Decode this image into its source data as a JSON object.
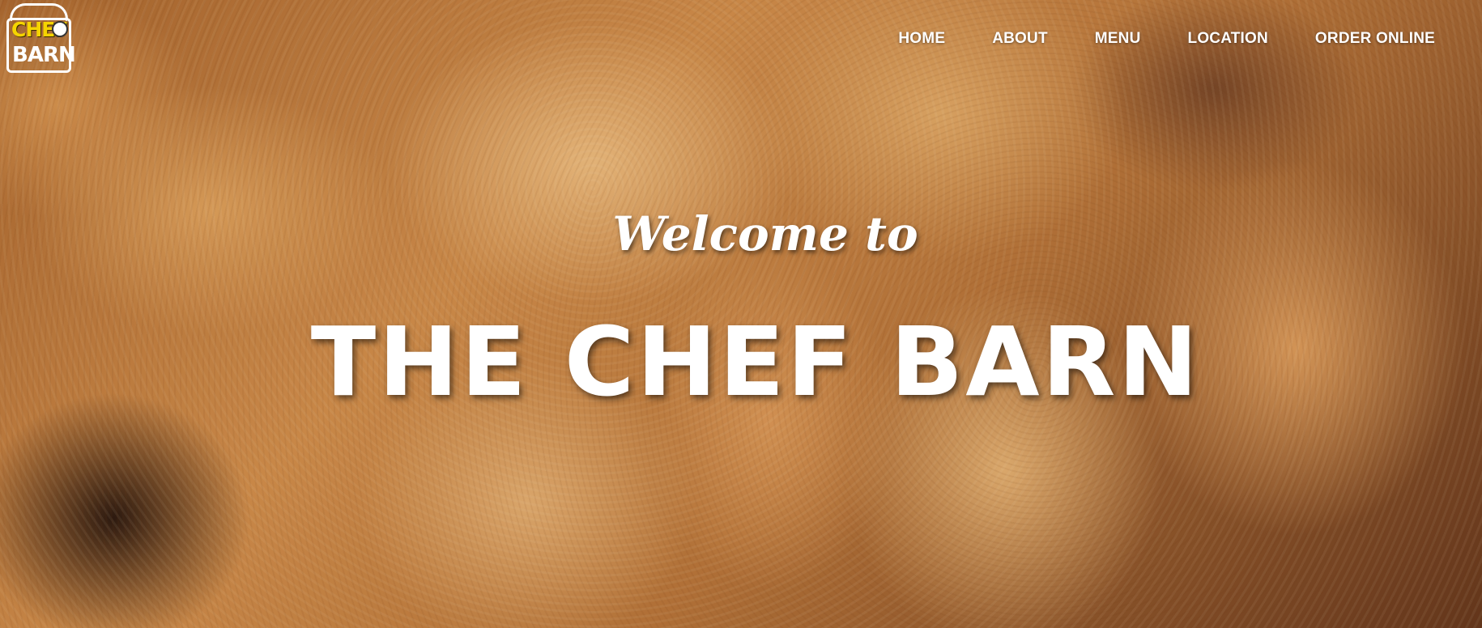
{
  "logo": {
    "line1": "CHEF",
    "line2": "BARN"
  },
  "nav": {
    "items": [
      {
        "label": "HOME"
      },
      {
        "label": "ABOUT"
      },
      {
        "label": "MENU"
      },
      {
        "label": "LOCATION"
      },
      {
        "label": "ORDER ONLINE"
      }
    ]
  },
  "hero": {
    "welcome": "Welcome to",
    "title": "THE CHEF BARN"
  },
  "colors": {
    "text": "#ffffff",
    "logo_accent": "#f5d400"
  }
}
